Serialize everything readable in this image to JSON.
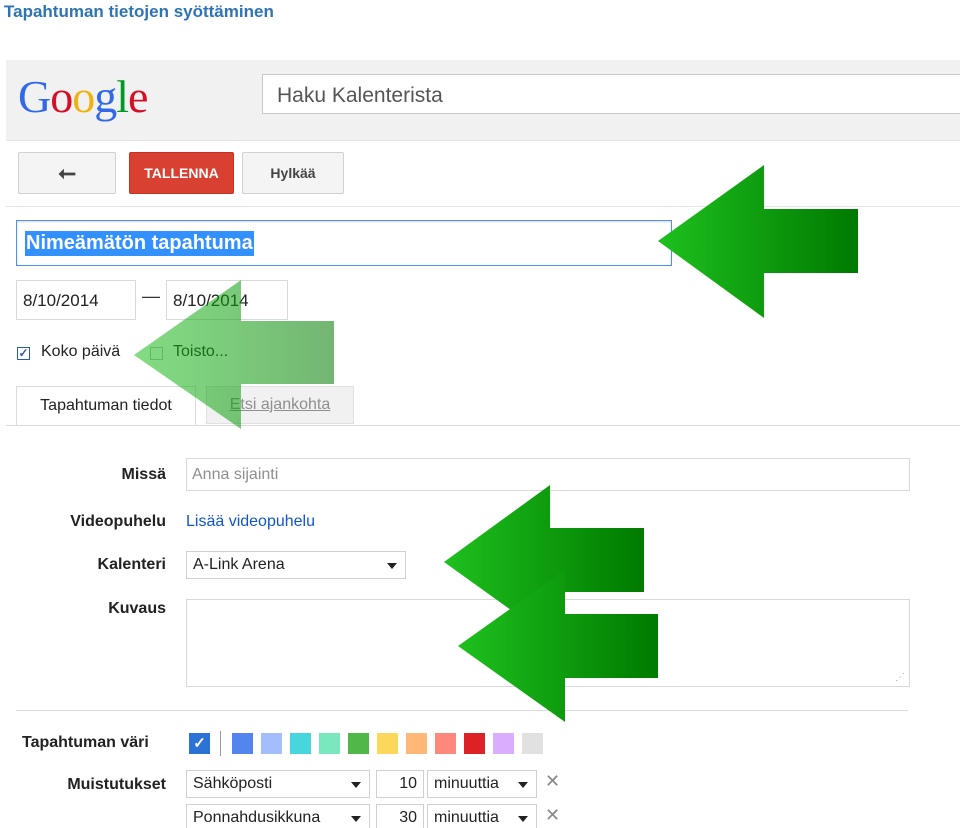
{
  "doc_title": "Tapahtuman tietojen syöttäminen",
  "logo": {
    "letters": [
      "G",
      "o",
      "o",
      "g",
      "l",
      "e"
    ],
    "colors": [
      "#3369e8",
      "#d50f25",
      "#eeb211",
      "#3369e8",
      "#009925",
      "#d50f25"
    ]
  },
  "search": {
    "placeholder": "Haku Kalenterista"
  },
  "toolbar": {
    "back_icon": "back-arrow-icon",
    "back_symbol": "⭠",
    "save_label": "TALLENNA",
    "discard_label": "Hylkää"
  },
  "event": {
    "title": "Nimeämätön tapahtuma",
    "start_date": "8/10/2014",
    "date_separator": "—",
    "end_date": "8/10/2014",
    "all_day_label": "Koko päivä",
    "all_day_checked": true,
    "repeat_label": "Toisto..."
  },
  "tabs": [
    "Tapahtuman tiedot",
    "Etsi ajankohta"
  ],
  "fields": {
    "where_label": "Missä",
    "where_placeholder": "Anna sijainti",
    "video_label": "Videopuhelu",
    "video_link": "Lisää videopuhelu",
    "calendar_label": "Kalenteri",
    "calendar_value": "A-Link Arena",
    "description_label": "Kuvaus",
    "color_label": "Tapahtuman väri",
    "reminders_label": "Muistutukset"
  },
  "colors": {
    "selected": "#2d73d6",
    "swatches": [
      "#5484ed",
      "#a4bdfc",
      "#46d6db",
      "#7ae7bf",
      "#51b749",
      "#fbd75b",
      "#ffb878",
      "#ff887c",
      "#dc2127",
      "#dbadff",
      "#e1e1e1"
    ]
  },
  "reminders": [
    {
      "method": "Sähköposti",
      "amount": "10",
      "unit": "minuuttia"
    },
    {
      "method": "Ponnahdusikkuna",
      "amount": "30",
      "unit": "minuuttia"
    }
  ],
  "annotations": {
    "arrow_color": "#00a000",
    "icon": "green-arrow-icon"
  }
}
